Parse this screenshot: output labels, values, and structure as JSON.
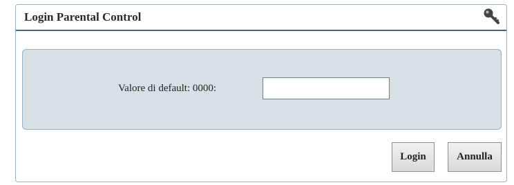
{
  "dialog": {
    "title": "Login Parental Control",
    "title_icon": "key-icon"
  },
  "form": {
    "label": "Valore di default: 0000:",
    "input_value": "",
    "input_type": "password"
  },
  "buttons": {
    "login_label": "Login",
    "cancel_label": "Annulla"
  },
  "colors": {
    "title_underline": "#3f6680",
    "panel_background": "#d6e0e5",
    "panel_border": "#8fb2c4"
  }
}
